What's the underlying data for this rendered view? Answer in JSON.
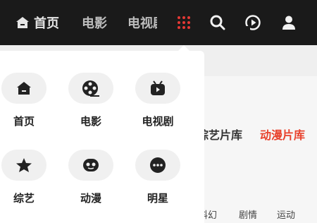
{
  "nav": {
    "home": "首页",
    "movie": "电影",
    "tv": "电视剧"
  },
  "menu": {
    "items": [
      {
        "label": "首页",
        "icon": "home-icon"
      },
      {
        "label": "电影",
        "icon": "film-reel-icon"
      },
      {
        "label": "电视剧",
        "icon": "tv-icon"
      },
      {
        "label": "综艺",
        "icon": "star-icon"
      },
      {
        "label": "动漫",
        "icon": "anime-face-icon"
      },
      {
        "label": "明星",
        "icon": "more-dots-icon"
      }
    ]
  },
  "libraries": {
    "variety": "综艺片库",
    "anime": "动漫片库"
  },
  "genres": [
    "科幻",
    "剧情",
    "运动"
  ],
  "colors": {
    "topbar": "#1a1a1a",
    "accent": "#e8412c",
    "grid_icon": "#e53935"
  }
}
